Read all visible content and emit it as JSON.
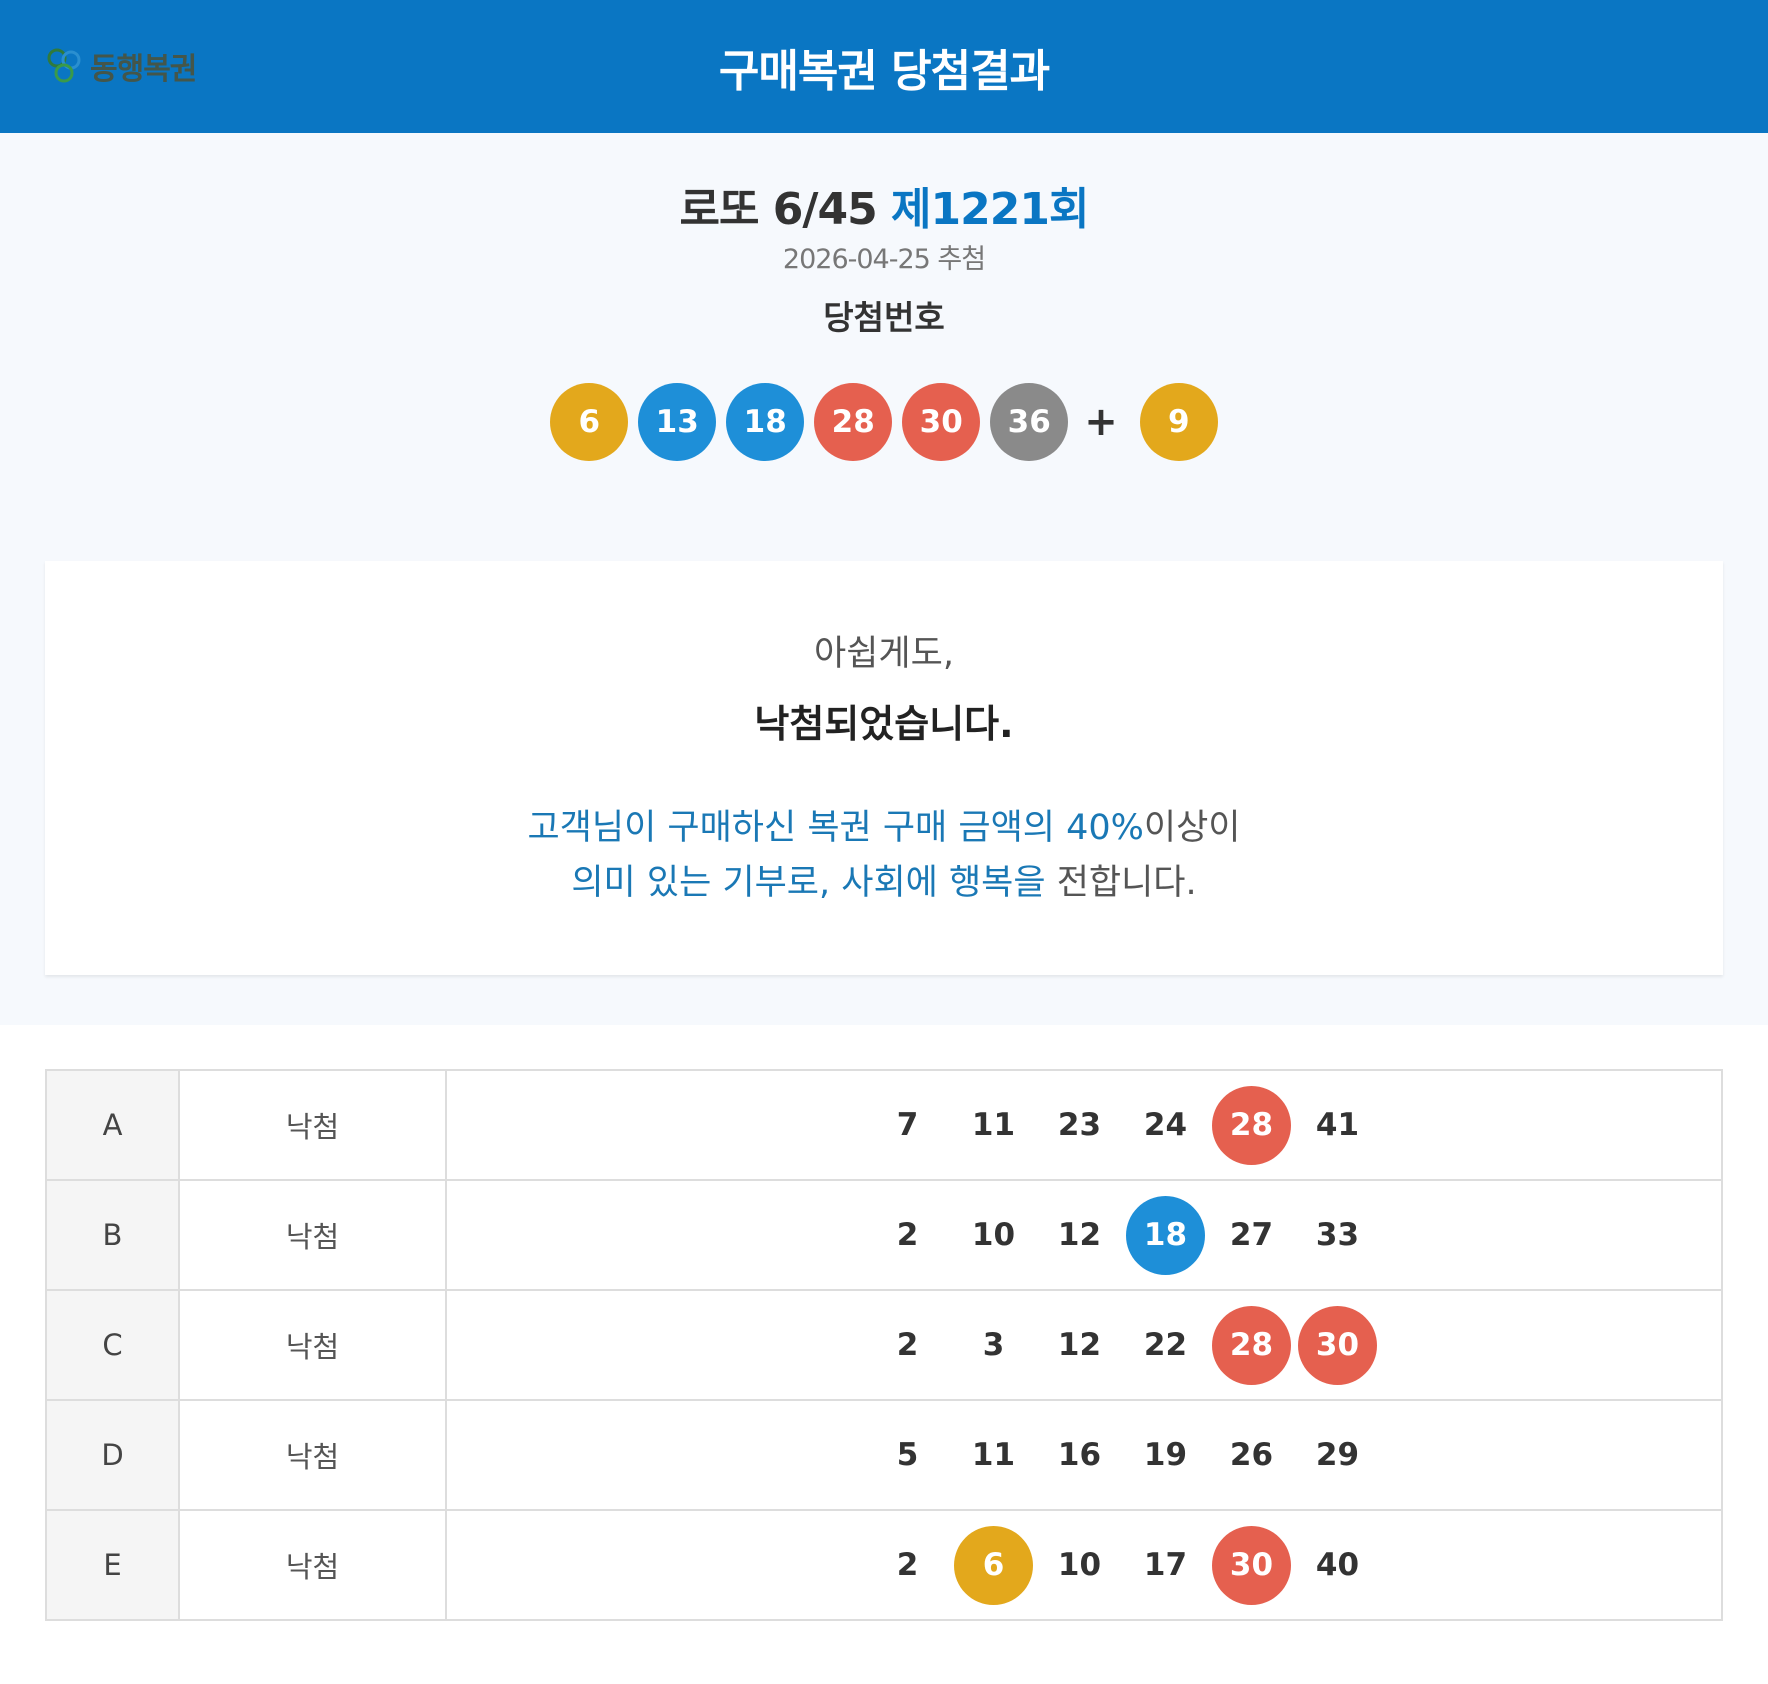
{
  "header": {
    "logo_text": "동행복권",
    "title": "구매복권 당첨결과"
  },
  "draw": {
    "game": "로또 6/45",
    "round": "제1221회",
    "date": "2026-04-25 추첨",
    "win_label": "당첨번호",
    "plus": "+",
    "numbers": [
      "6",
      "13",
      "18",
      "28",
      "30",
      "36"
    ],
    "bonus": "9"
  },
  "result": {
    "sub": "아쉽게도,",
    "main": "낙첨되었습니다.",
    "donation_line1_blue": "고객님이 구매하신 복권 구매 금액의 40%",
    "donation_line1_grey": "이상이",
    "donation_line2_blue": "의미 있는 기부로, 사회에 행복을",
    "donation_line2_grey": " 전합니다."
  },
  "ball_colors": {
    "yellow": "#e3a81c",
    "blue": "#1e8fd8",
    "red": "#e5604f",
    "grey": "#8a8a8a"
  },
  "tickets": [
    {
      "id": "A",
      "status": "낙첨",
      "numbers": [
        "7",
        "11",
        "23",
        "24",
        "28",
        "41"
      ],
      "hits": [
        false,
        false,
        false,
        false,
        true,
        false
      ]
    },
    {
      "id": "B",
      "status": "낙첨",
      "numbers": [
        "2",
        "10",
        "12",
        "18",
        "27",
        "33"
      ],
      "hits": [
        false,
        false,
        false,
        true,
        false,
        false
      ]
    },
    {
      "id": "C",
      "status": "낙첨",
      "numbers": [
        "2",
        "3",
        "12",
        "22",
        "28",
        "30"
      ],
      "hits": [
        false,
        false,
        false,
        false,
        true,
        true
      ]
    },
    {
      "id": "D",
      "status": "낙첨",
      "numbers": [
        "5",
        "11",
        "16",
        "19",
        "26",
        "29"
      ],
      "hits": [
        false,
        false,
        false,
        false,
        false,
        false
      ]
    },
    {
      "id": "E",
      "status": "낙첨",
      "numbers": [
        "2",
        "6",
        "10",
        "17",
        "30",
        "40"
      ],
      "hits": [
        false,
        true,
        false,
        false,
        true,
        false
      ]
    }
  ]
}
